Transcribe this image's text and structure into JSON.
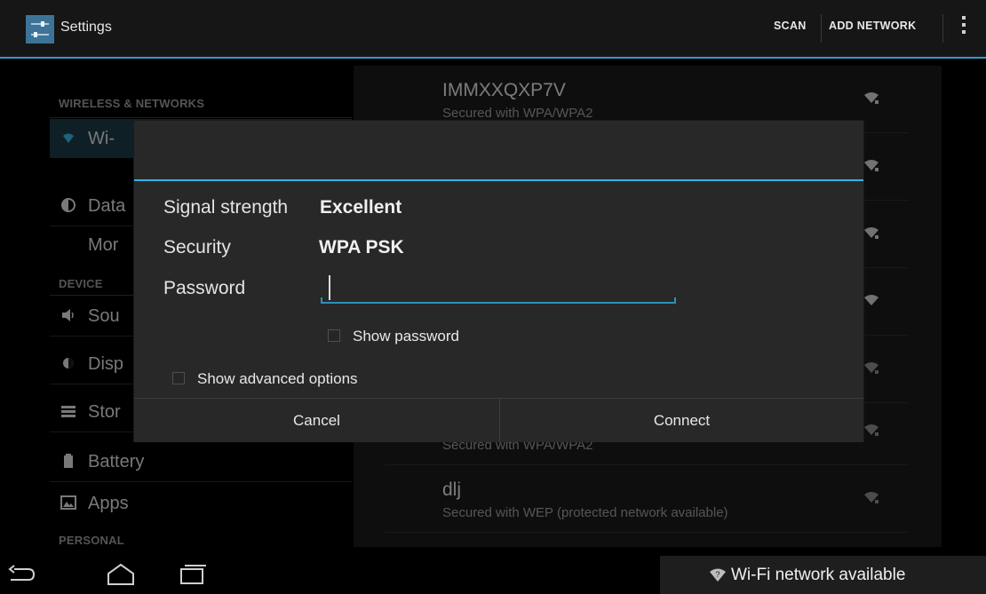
{
  "actionbar": {
    "title": "Settings",
    "scan_label": "SCAN",
    "add_network_label": "ADD NETWORK"
  },
  "left": {
    "wireless_header": "WIRELESS & NETWORKS",
    "device_header": "DEVICE",
    "personal_header": "PERSONAL",
    "items": {
      "wifi": "Wi-",
      "data": "Data",
      "more": "Mor",
      "sound": "Sou",
      "display": "Disp",
      "storage": "Stor",
      "battery": "Battery",
      "apps": "Apps"
    }
  },
  "networks": [
    {
      "name": "IMMXXQXP7V",
      "sub": "Secured with WPA/WPA2"
    },
    {
      "name": "",
      "sub": "Secured with WPA/WPA2"
    },
    {
      "name": "dlj",
      "sub": "Secured with WEP (protected network available)"
    }
  ],
  "dialog": {
    "signal_label": "Signal strength",
    "signal_value": "Excellent",
    "security_label": "Security",
    "security_value": "WPA PSK",
    "password_label": "Password",
    "password_value": "",
    "show_password_label": "Show password",
    "show_advanced_label": "Show advanced options",
    "cancel_label": "Cancel",
    "connect_label": "Connect"
  },
  "notification": {
    "text": "Wi-Fi network available"
  },
  "colors": {
    "accent": "#33b5e5",
    "actionbar_bg": "#161616",
    "dialog_bg": "#282828"
  },
  "icons": {
    "app": "settings-sliders-icon",
    "overflow": "overflow-menu-icon",
    "wifi_signal": "wifi-signal-icon",
    "back": "back-icon",
    "home": "home-icon",
    "recents": "recent-apps-icon"
  }
}
